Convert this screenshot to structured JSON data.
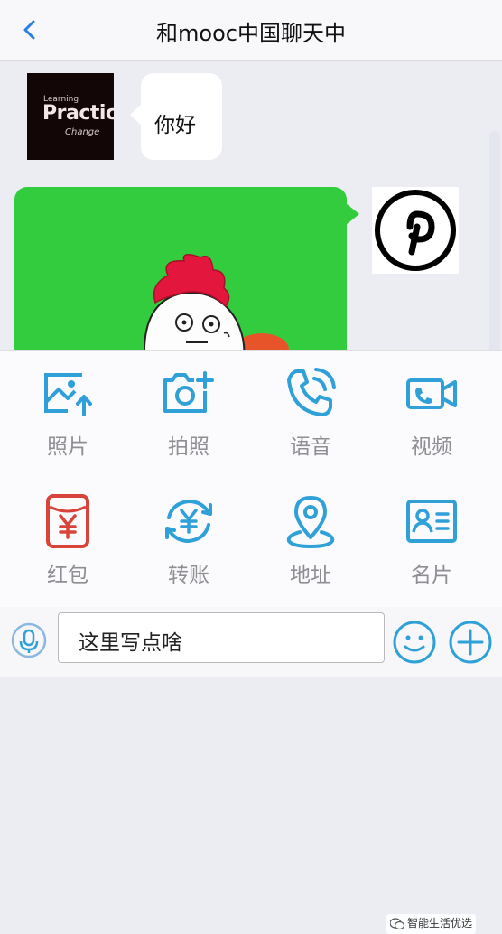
{
  "header": {
    "title": "和mooc中国聊天中"
  },
  "chat": {
    "left_message": "你好",
    "left_avatar_text": [
      "Learning",
      "Practice",
      "Change"
    ]
  },
  "panel": {
    "items": [
      {
        "label": "照片",
        "icon": "photo-icon",
        "color": "#2fa0d8"
      },
      {
        "label": "拍照",
        "icon": "camera-icon",
        "color": "#2fa0d8"
      },
      {
        "label": "语音",
        "icon": "phone-icon",
        "color": "#2fa0d8"
      },
      {
        "label": "视频",
        "icon": "video-icon",
        "color": "#2fa0d8"
      },
      {
        "label": "红包",
        "icon": "red-packet-icon",
        "color": "#d9443a"
      },
      {
        "label": "转账",
        "icon": "transfer-icon",
        "color": "#2fa0d8"
      },
      {
        "label": "地址",
        "icon": "location-icon",
        "color": "#2fa0d8"
      },
      {
        "label": "名片",
        "icon": "contact-card-icon",
        "color": "#2fa0d8"
      }
    ]
  },
  "input": {
    "placeholder": "这里写点啥"
  },
  "watermark": "智能生活优选",
  "colors": {
    "accent": "#2fa0d8",
    "green_bubble": "#33cc3e",
    "red": "#d9443a"
  }
}
